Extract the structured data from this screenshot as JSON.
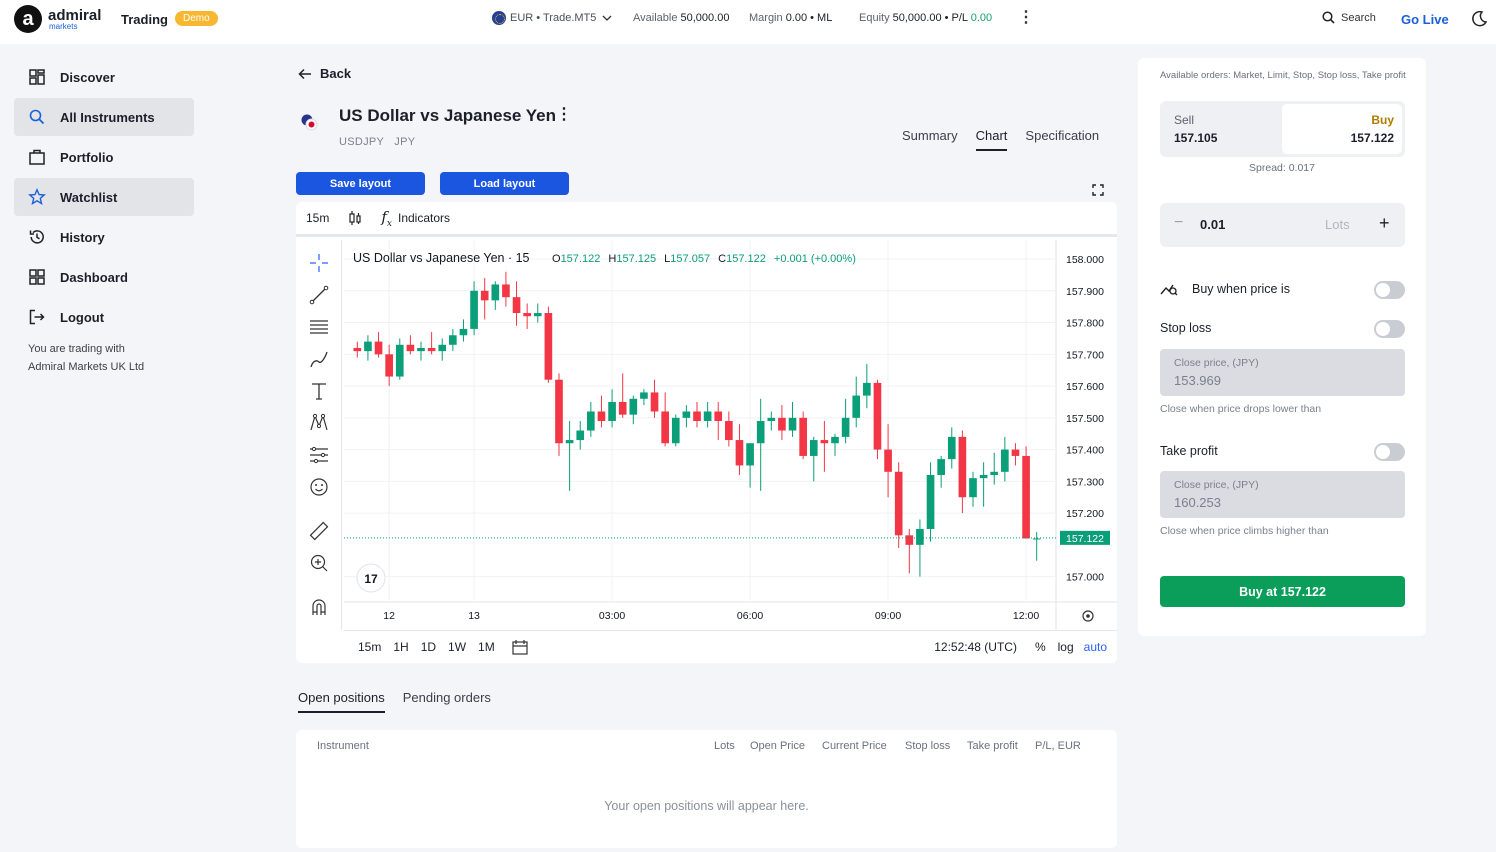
{
  "header": {
    "logo_main": "admiral",
    "logo_sub": "markets",
    "app_name": "Trading",
    "demo_badge": "Demo",
    "account": "EUR • Trade.MT5",
    "available_label": "Available",
    "available_value": "50,000.00",
    "margin_label": "Margin",
    "margin_value": "0.00 • ML",
    "equity_label": "Equity",
    "equity_value": "50,000.00 • P/L",
    "pl_value": "0.00",
    "search_label": "Search",
    "golive_label": "Go Live"
  },
  "sidebar": {
    "items": [
      {
        "label": "Discover",
        "icon": "grid-icon"
      },
      {
        "label": "All Instruments",
        "icon": "search-icon"
      },
      {
        "label": "Portfolio",
        "icon": "briefcase-icon"
      },
      {
        "label": "Watchlist",
        "icon": "star-icon"
      },
      {
        "label": "History",
        "icon": "history-icon"
      },
      {
        "label": "Dashboard",
        "icon": "dashboard-icon"
      },
      {
        "label": "Logout",
        "icon": "logout-icon"
      }
    ],
    "note_line1": "You are trading with",
    "note_line2": "Admiral Markets UK Ltd"
  },
  "instrument": {
    "back_label": "Back",
    "title": "US Dollar vs Japanese Yen",
    "symbol": "USDJPY",
    "currency": "JPY",
    "tabs": [
      "Summary",
      "Chart",
      "Specification"
    ],
    "active_tab": "Chart",
    "save_layout": "Save layout",
    "load_layout": "Load layout"
  },
  "chart_toolbar": {
    "interval": "15m",
    "indicators_label": "Indicators"
  },
  "chart_footer": {
    "timeframes": [
      "15m",
      "1H",
      "1D",
      "1W",
      "1M"
    ],
    "clock": "12:52:48 (UTC)",
    "percent": "%",
    "log": "log",
    "auto": "auto"
  },
  "chart_data": {
    "type": "candlestick",
    "title": "US Dollar vs Japanese Yen · 15",
    "ohlc_readout": {
      "O": "157.122",
      "H": "157.125",
      "L": "157.057",
      "C": "157.122",
      "change": "+0.001 (+0.00%)"
    },
    "ylim": [
      156.92,
      158.06
    ],
    "y_ticks": [
      "158.000",
      "157.900",
      "157.800",
      "157.700",
      "157.600",
      "157.500",
      "157.400",
      "157.300",
      "157.200",
      "157.000"
    ],
    "current_price": "157.122",
    "x_ticks": [
      "12",
      "13",
      "03:00",
      "06:00",
      "09:00",
      "12:00"
    ],
    "up_color": "#0a9e79",
    "down_color": "#f23645",
    "candles": [
      [
        157.72,
        157.74,
        157.69,
        157.71
      ],
      [
        157.71,
        157.76,
        157.68,
        157.74
      ],
      [
        157.74,
        157.77,
        157.69,
        157.7
      ],
      [
        157.7,
        157.73,
        157.6,
        157.63
      ],
      [
        157.63,
        157.75,
        157.62,
        157.73
      ],
      [
        157.73,
        157.76,
        157.7,
        157.71
      ],
      [
        157.71,
        157.74,
        157.68,
        157.72
      ],
      [
        157.72,
        157.77,
        157.7,
        157.71
      ],
      [
        157.71,
        157.75,
        157.68,
        157.73
      ],
      [
        157.73,
        157.78,
        157.71,
        157.76
      ],
      [
        157.76,
        157.81,
        157.74,
        157.78
      ],
      [
        157.78,
        157.93,
        157.76,
        157.9
      ],
      [
        157.9,
        157.94,
        157.81,
        157.87
      ],
      [
        157.87,
        157.93,
        157.84,
        157.92
      ],
      [
        157.92,
        157.96,
        157.85,
        157.88
      ],
      [
        157.88,
        157.93,
        157.79,
        157.83
      ],
      [
        157.83,
        157.86,
        157.78,
        157.82
      ],
      [
        157.82,
        157.86,
        157.8,
        157.83
      ],
      [
        157.83,
        157.85,
        157.61,
        157.62
      ],
      [
        157.62,
        157.64,
        157.38,
        157.42
      ],
      [
        157.42,
        157.49,
        157.27,
        157.43
      ],
      [
        157.43,
        157.49,
        157.4,
        157.46
      ],
      [
        157.46,
        157.55,
        157.44,
        157.52
      ],
      [
        157.52,
        157.57,
        157.47,
        157.49
      ],
      [
        157.49,
        157.59,
        157.47,
        157.55
      ],
      [
        157.55,
        157.64,
        157.5,
        157.51
      ],
      [
        157.51,
        157.57,
        157.48,
        157.56
      ],
      [
        157.56,
        157.59,
        157.54,
        157.58
      ],
      [
        157.58,
        157.62,
        157.5,
        157.52
      ],
      [
        157.52,
        157.58,
        157.41,
        157.42
      ],
      [
        157.42,
        157.51,
        157.41,
        157.5
      ],
      [
        157.5,
        157.54,
        157.47,
        157.52
      ],
      [
        157.52,
        157.55,
        157.47,
        157.49
      ],
      [
        157.49,
        157.55,
        157.47,
        157.52
      ],
      [
        157.52,
        157.55,
        157.43,
        157.49
      ],
      [
        157.49,
        157.52,
        157.41,
        157.43
      ],
      [
        157.43,
        157.48,
        157.32,
        157.35
      ],
      [
        157.35,
        157.42,
        157.28,
        157.42
      ],
      [
        157.42,
        157.56,
        157.27,
        157.49
      ],
      [
        157.49,
        157.52,
        157.46,
        157.5
      ],
      [
        157.5,
        157.54,
        157.43,
        157.46
      ],
      [
        157.46,
        157.55,
        157.44,
        157.5
      ],
      [
        157.5,
        157.52,
        157.37,
        157.38
      ],
      [
        157.38,
        157.44,
        157.3,
        157.43
      ],
      [
        157.43,
        157.49,
        157.33,
        157.42
      ],
      [
        157.42,
        157.45,
        157.38,
        157.44
      ],
      [
        157.44,
        157.56,
        157.42,
        157.5
      ],
      [
        157.5,
        157.63,
        157.47,
        157.57
      ],
      [
        157.57,
        157.67,
        157.53,
        157.61
      ],
      [
        157.61,
        157.62,
        157.37,
        157.4
      ],
      [
        157.4,
        157.48,
        157.25,
        157.33
      ],
      [
        157.33,
        157.36,
        157.09,
        157.13
      ],
      [
        157.13,
        157.15,
        157.01,
        157.1
      ],
      [
        157.1,
        157.18,
        157.0,
        157.15
      ],
      [
        157.15,
        157.36,
        157.11,
        157.32
      ],
      [
        157.32,
        157.38,
        157.28,
        157.37
      ],
      [
        157.37,
        157.47,
        157.34,
        157.44
      ],
      [
        157.44,
        157.46,
        157.2,
        157.25
      ],
      [
        157.25,
        157.33,
        157.22,
        157.31
      ],
      [
        157.31,
        157.36,
        157.22,
        157.32
      ],
      [
        157.32,
        157.39,
        157.29,
        157.33
      ],
      [
        157.33,
        157.44,
        157.3,
        157.4
      ],
      [
        157.4,
        157.42,
        157.35,
        157.38
      ],
      [
        157.38,
        157.41,
        157.12,
        157.12
      ],
      [
        157.12,
        157.14,
        157.05,
        157.12
      ]
    ]
  },
  "order_panel": {
    "available_orders": "Available orders: Market, Limit, Stop, Stop loss, Take profit",
    "sell_label": "Sell",
    "sell_price": "157.105",
    "buy_label": "Buy",
    "buy_price": "157.122",
    "spread": "Spread: 0.017",
    "lots_value": "0.01",
    "lots_unit": "Lots",
    "buy_when_label": "Buy when price is",
    "stop_loss_label": "Stop loss",
    "sl_price_label": "Close price, (JPY)",
    "sl_price_value": "153.969",
    "sl_hint": "Close when price drops lower than",
    "take_profit_label": "Take profit",
    "tp_price_label": "Close price, (JPY)",
    "tp_price_value": "160.253",
    "tp_hint": "Close when price climbs higher than",
    "buy_button": "Buy at 157.122"
  },
  "positions": {
    "tabs": [
      "Open positions",
      "Pending orders"
    ],
    "columns": [
      "Instrument",
      "Lots",
      "Open Price",
      "Current Price",
      "Stop loss",
      "Take profit",
      "P/L, EUR"
    ],
    "empty_text": "Your open positions will appear here."
  }
}
